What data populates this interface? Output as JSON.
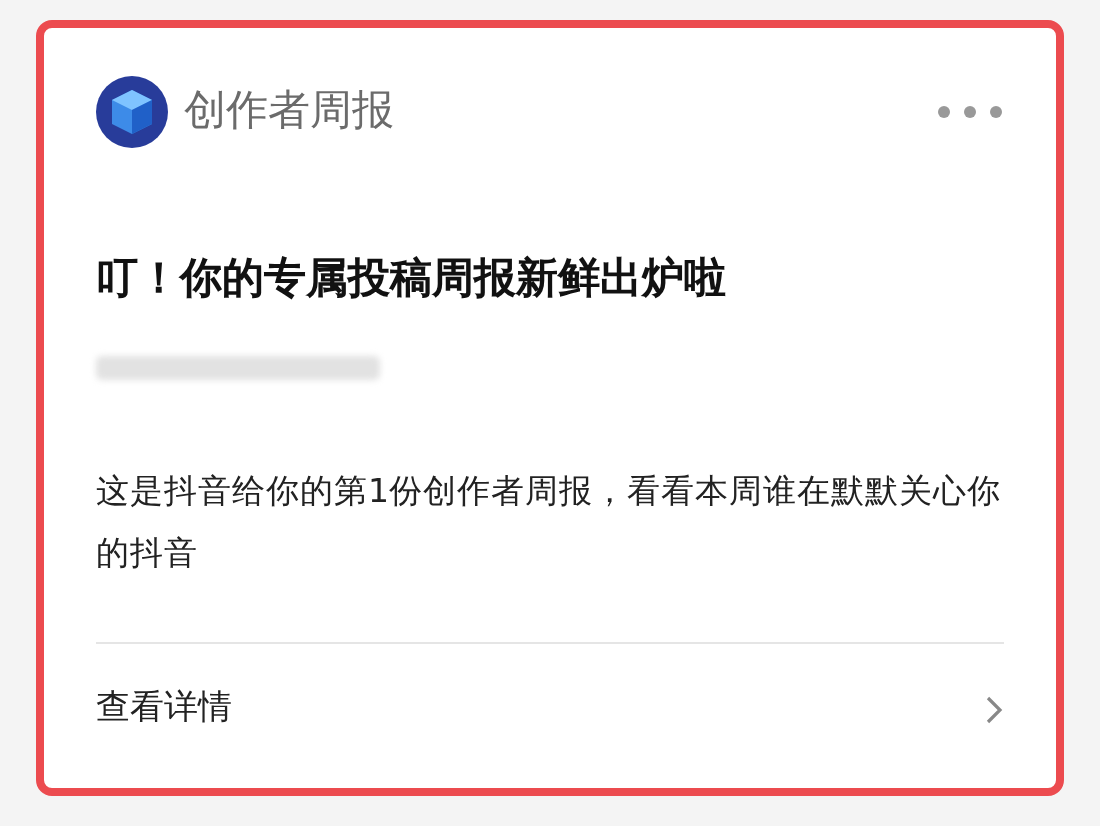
{
  "header": {
    "title": "创作者周报"
  },
  "headline": "叮！你的专属投稿周报新鲜出炉啦",
  "description": "这是抖音给你的第1份创作者周报，看看本周谁在默默关心你的抖音",
  "footer": {
    "link": "查看详情"
  }
}
